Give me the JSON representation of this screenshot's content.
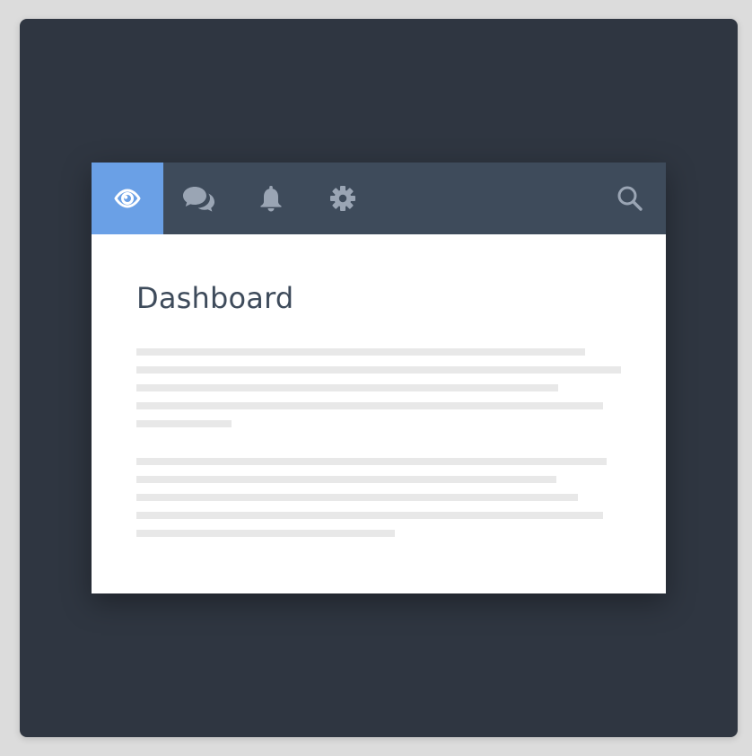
{
  "navbar": {
    "items": [
      {
        "icon": "eye-icon",
        "active": true
      },
      {
        "icon": "chat-icon",
        "active": false
      },
      {
        "icon": "bell-icon",
        "active": false
      },
      {
        "icon": "gear-icon",
        "active": false
      }
    ],
    "search_icon": "search-icon"
  },
  "colors": {
    "frame": "#2f3641",
    "navbar": "#3e4b5b",
    "active": "#6aa0e6",
    "icon": "#9aa5b4",
    "title": "#3e4b5b",
    "placeholder_line": "#e8e8e8"
  },
  "main": {
    "title": "Dashboard"
  }
}
